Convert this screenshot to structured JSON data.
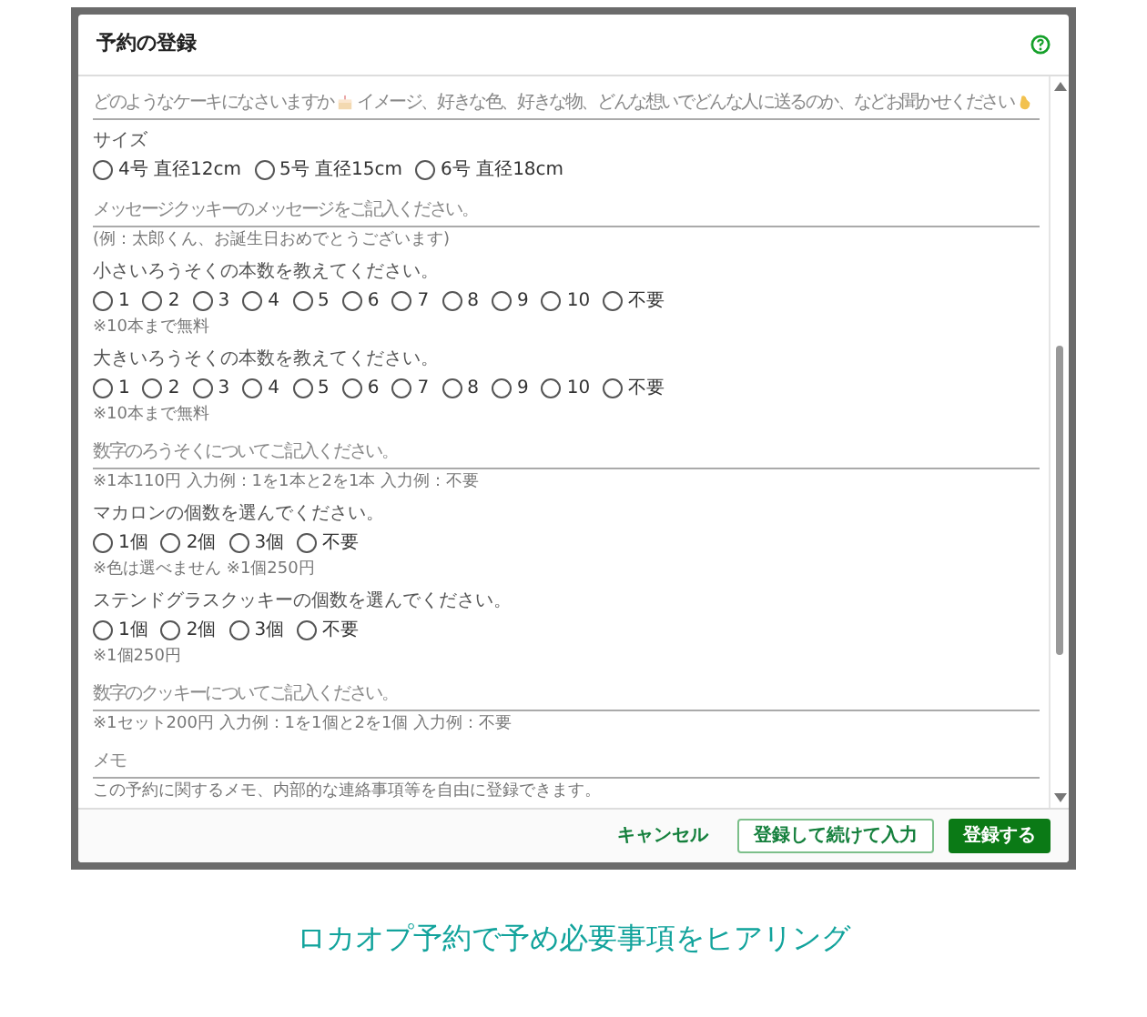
{
  "dialog": {
    "title": "予約の登録",
    "fields": [
      {
        "kind": "text",
        "placeholder_parts": [
          "どのようなケーキになさいますか",
          "イメージ、好きな色、好きな物、どんな想いでどんな人に送るのか、などお聞かせください"
        ]
      },
      {
        "kind": "radio",
        "label": "サイズ",
        "options": [
          {
            "label": "4号 直径12cm",
            "selected": false
          },
          {
            "label": "5号 直径15cm",
            "selected": false
          },
          {
            "label": "6号 直径18cm",
            "selected": false
          }
        ]
      },
      {
        "kind": "text",
        "placeholder_parts": [
          "メッセージクッキーのメッセージをご記入ください。"
        ],
        "help": "(例：太郎くん、お誕生日おめでとうございます)"
      },
      {
        "kind": "radio",
        "label": "小さいろうそくの本数を教えてください。",
        "options": [
          {
            "label": "1",
            "selected": false
          },
          {
            "label": "2",
            "selected": false
          },
          {
            "label": "3",
            "selected": false
          },
          {
            "label": "4",
            "selected": false
          },
          {
            "label": "5",
            "selected": false
          },
          {
            "label": "6",
            "selected": false
          },
          {
            "label": "7",
            "selected": false
          },
          {
            "label": "8",
            "selected": false
          },
          {
            "label": "9",
            "selected": false
          },
          {
            "label": "10",
            "selected": false
          },
          {
            "label": "不要",
            "selected": false
          }
        ],
        "help": "※10本まで無料"
      },
      {
        "kind": "radio",
        "label": "大きいろうそくの本数を教えてください。",
        "options": [
          {
            "label": "1",
            "selected": false
          },
          {
            "label": "2",
            "selected": false
          },
          {
            "label": "3",
            "selected": false
          },
          {
            "label": "4",
            "selected": false
          },
          {
            "label": "5",
            "selected": false
          },
          {
            "label": "6",
            "selected": false
          },
          {
            "label": "7",
            "selected": false
          },
          {
            "label": "8",
            "selected": false
          },
          {
            "label": "9",
            "selected": false
          },
          {
            "label": "10",
            "selected": false
          },
          {
            "label": "不要",
            "selected": false
          }
        ],
        "help": "※10本まで無料"
      },
      {
        "kind": "text",
        "placeholder_parts": [
          "数字のろうそくについてご記入ください。"
        ],
        "help": "※1本110円 入力例：1を1本と2を1本 入力例：不要"
      },
      {
        "kind": "radio",
        "label": "マカロンの個数を選んでください。",
        "options": [
          {
            "label": "1個",
            "selected": false
          },
          {
            "label": "2個",
            "selected": false
          },
          {
            "label": "3個",
            "selected": false
          },
          {
            "label": "不要",
            "selected": false
          }
        ],
        "help": "※色は選べません ※1個250円"
      },
      {
        "kind": "radio",
        "label": "ステンドグラスクッキーの個数を選んでください。",
        "options": [
          {
            "label": "1個",
            "selected": false
          },
          {
            "label": "2個",
            "selected": false
          },
          {
            "label": "3個",
            "selected": false
          },
          {
            "label": "不要",
            "selected": false
          }
        ],
        "help": "※1個250円"
      },
      {
        "kind": "text",
        "placeholder_parts": [
          "数字のクッキーについてご記入ください。"
        ],
        "help": "※1セット200円 入力例：1を1個と2を1個 入力例：不要"
      },
      {
        "kind": "text",
        "placeholder_parts": [
          "メモ"
        ],
        "help": "この予約に関するメモ、内部的な連絡事項等を自由に登録できます。"
      }
    ],
    "buttons": [
      {
        "kind": "text",
        "label": "キャンセル"
      },
      {
        "kind": "outline",
        "label": "登録して続けて入力"
      },
      {
        "kind": "filled",
        "label": "登録する"
      }
    ]
  },
  "caption": "ロカオプ予約で予め必要事項をヒアリング"
}
